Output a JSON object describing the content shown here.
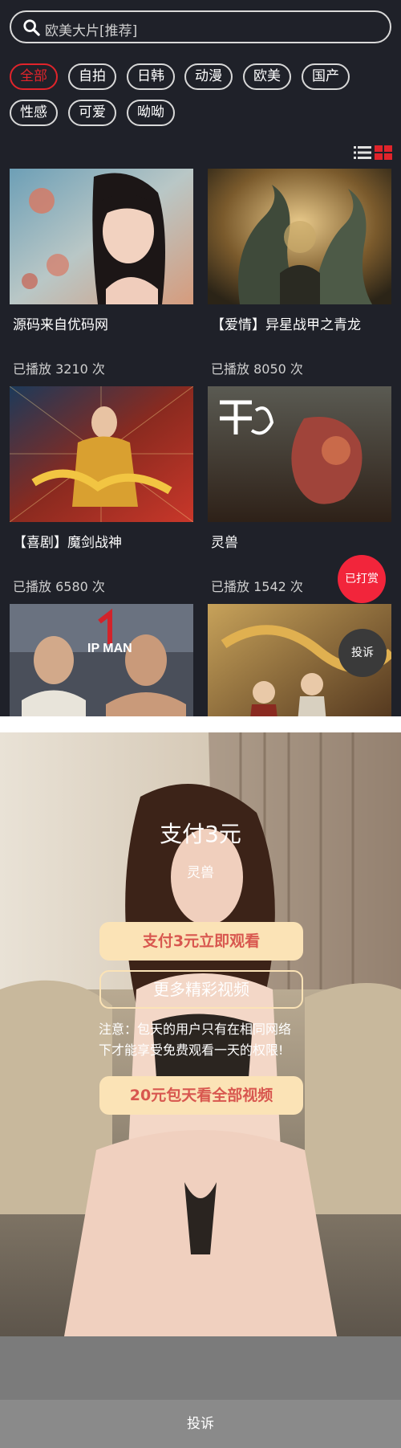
{
  "search": {
    "placeholder": "欧美大片[推荐]"
  },
  "tags": [
    {
      "label": "全部",
      "active": true
    },
    {
      "label": "自拍"
    },
    {
      "label": "日韩"
    },
    {
      "label": "动漫"
    },
    {
      "label": "欧美"
    },
    {
      "label": "国产"
    },
    {
      "label": "性感"
    },
    {
      "label": "可爱"
    },
    {
      "label": "呦呦"
    }
  ],
  "cards": [
    {
      "title": "源码来自优码网",
      "plays": "已播放 3210 次",
      "thumb": "portrait-photo"
    },
    {
      "title": "【爱情】异星战甲之青龙",
      "plays": "已播放 8050 次",
      "thumb": "dragon-poster"
    },
    {
      "title": "【喜剧】魔剑战神",
      "plays": "已播放 6580 次",
      "thumb": "warrior-poster"
    },
    {
      "title": "灵兽",
      "plays": "已播放 1542 次",
      "thumb": "beast-poster"
    },
    {
      "title": "",
      "plays": "",
      "thumb": "ipman-poster",
      "poster_text": "IP MAN"
    },
    {
      "title": "",
      "plays": "",
      "thumb": "fantasy-poster"
    }
  ],
  "float": {
    "reward": "已打赏",
    "report": "投诉"
  },
  "pay": {
    "title": "支付3元",
    "subtitle": "灵兽",
    "primary_button": "支付3元立即观看",
    "more_button": "更多精彩视频",
    "notice_line1": "注意：包天的用户只有在相同网络",
    "notice_line2": "下才能享受免费观看一天的权限!",
    "daily_button": "20元包天看全部视频",
    "report": "投诉"
  },
  "colors": {
    "background": "#1f2129",
    "accent": "#e0242b",
    "reward": "#f2253b",
    "pay_button": "#fbe3b6",
    "pay_text": "#d8574f"
  }
}
